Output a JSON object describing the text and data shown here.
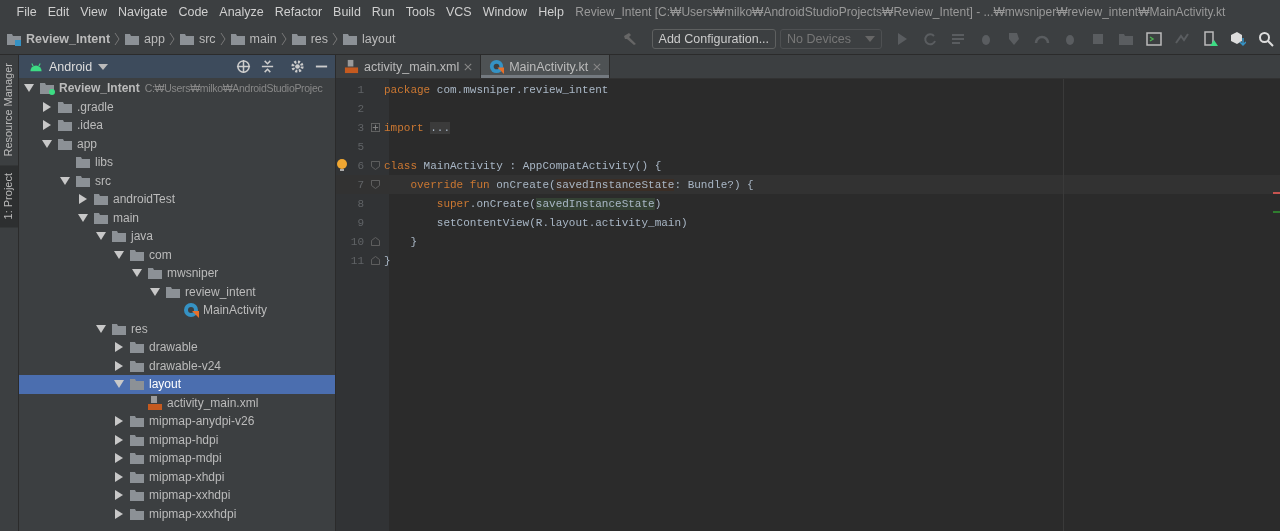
{
  "menu": [
    "File",
    "Edit",
    "View",
    "Navigate",
    "Code",
    "Analyze",
    "Refactor",
    "Build",
    "Run",
    "Tools",
    "VCS",
    "Window",
    "Help"
  ],
  "window": {
    "title": "Review_Intent [C:₩Users₩milko₩AndroidStudioProjects₩Review_Intent] - ...₩mwsniper₩review_intent₩MainActivity.kt"
  },
  "breadcrumb": [
    {
      "label": "Review_Intent",
      "kind": "module"
    },
    {
      "label": "app",
      "kind": "folder"
    },
    {
      "label": "src",
      "kind": "folder"
    },
    {
      "label": "main",
      "kind": "folder"
    },
    {
      "label": "res",
      "kind": "folder"
    },
    {
      "label": "layout",
      "kind": "folder"
    }
  ],
  "toolbar": {
    "config_button": "Add Configuration...",
    "device_select": "No Devices"
  },
  "side_tabs": [
    {
      "label": "Resource Manager",
      "selected": false
    },
    {
      "label": "1: Project",
      "selected": true
    }
  ],
  "project_panel": {
    "view": "Android"
  },
  "tree": [
    {
      "label": "Review_Intent",
      "kind": "module",
      "path": "C:₩Users₩milko₩AndroidStudioProjec",
      "expanded": true,
      "selected": false,
      "children": [
        {
          "label": ".gradle",
          "kind": "folder",
          "expanded": false,
          "selected": false
        },
        {
          "label": ".idea",
          "kind": "folder",
          "expanded": false,
          "selected": false
        },
        {
          "label": "app",
          "kind": "folder",
          "expanded": true,
          "selected": false,
          "children": [
            {
              "label": "libs",
              "kind": "folder",
              "selected": false
            },
            {
              "label": "src",
              "kind": "folder",
              "expanded": true,
              "selected": false,
              "children": [
                {
                  "label": "androidTest",
                  "kind": "folder",
                  "expanded": false,
                  "selected": false
                },
                {
                  "label": "main",
                  "kind": "folder",
                  "expanded": true,
                  "selected": false,
                  "children": [
                    {
                      "label": "java",
                      "kind": "folder",
                      "expanded": true,
                      "selected": false,
                      "children": [
                        {
                          "label": "com",
                          "kind": "folder",
                          "expanded": true,
                          "selected": false,
                          "children": [
                            {
                              "label": "mwsniper",
                              "kind": "folder",
                              "expanded": true,
                              "selected": false,
                              "children": [
                                {
                                  "label": "review_intent",
                                  "kind": "folder",
                                  "expanded": true,
                                  "selected": false,
                                  "children": [
                                    {
                                      "label": "MainActivity",
                                      "kind": "kotlin",
                                      "selected": false
                                    }
                                  ]
                                }
                              ]
                            }
                          ]
                        }
                      ]
                    },
                    {
                      "label": "res",
                      "kind": "folder",
                      "expanded": true,
                      "selected": false,
                      "children": [
                        {
                          "label": "drawable",
                          "kind": "folder",
                          "expanded": false,
                          "selected": false
                        },
                        {
                          "label": "drawable-v24",
                          "kind": "folder",
                          "expanded": false,
                          "selected": false
                        },
                        {
                          "label": "layout",
                          "kind": "folder",
                          "expanded": true,
                          "selected": true,
                          "children": [
                            {
                              "label": "activity_main.xml",
                              "kind": "xml",
                              "selected": false
                            }
                          ]
                        },
                        {
                          "label": "mipmap-anydpi-v26",
                          "kind": "folder",
                          "expanded": false,
                          "selected": false
                        },
                        {
                          "label": "mipmap-hdpi",
                          "kind": "folder",
                          "expanded": false,
                          "selected": false
                        },
                        {
                          "label": "mipmap-mdpi",
                          "kind": "folder",
                          "expanded": false,
                          "selected": false
                        },
                        {
                          "label": "mipmap-xhdpi",
                          "kind": "folder",
                          "expanded": false,
                          "selected": false
                        },
                        {
                          "label": "mipmap-xxhdpi",
                          "kind": "folder",
                          "expanded": false,
                          "selected": false
                        },
                        {
                          "label": "mipmap-xxxhdpi",
                          "kind": "folder",
                          "expanded": false,
                          "selected": false
                        }
                      ]
                    }
                  ]
                }
              ]
            }
          ]
        }
      ]
    }
  ],
  "editor_tabs": [
    {
      "label": "activity_main.xml",
      "kind": "xml",
      "selected": false
    },
    {
      "label": "MainActivity.kt",
      "kind": "kotlin",
      "selected": true
    }
  ],
  "code": [
    {
      "number": "1",
      "kind": "plain",
      "tokens": [
        {
          "text": "package ",
          "kind": "kw"
        },
        {
          "text": "com.mwsniper.review_intent",
          "kind": "plain"
        }
      ]
    },
    {
      "number": "2",
      "kind": "plain"
    },
    {
      "number": "3",
      "kind": "folded",
      "tokens": [
        {
          "text": "import ",
          "kind": "kw"
        },
        {
          "text": "...",
          "kind": "folded"
        }
      ]
    },
    {
      "number": "5",
      "kind": "plain"
    },
    {
      "number": "6",
      "kind": "fold-start",
      "tokens": [
        {
          "text": "class ",
          "kind": "kw"
        },
        {
          "text": "MainActivity : AppCompatActivity() {",
          "kind": "plain"
        }
      ]
    },
    {
      "number": "7",
      "kind": "fold-start",
      "current": true,
      "tokens": [
        {
          "text": "    override fun ",
          "kind": "kw"
        },
        {
          "text": "onCreate(",
          "kind": "plain"
        },
        {
          "text": "savedInstanceState",
          "kind": "param"
        },
        {
          "text": ": Bundle?) {",
          "kind": "plain"
        }
      ]
    },
    {
      "number": "8",
      "kind": "plain",
      "tokens": [
        {
          "text": "        super",
          "kind": "kw"
        },
        {
          "text": ".onCreate(",
          "kind": "plain"
        },
        {
          "text": "savedInstanceState",
          "kind": "usage"
        },
        {
          "text": ")",
          "kind": "plain"
        }
      ]
    },
    {
      "number": "9",
      "kind": "plain",
      "tokens": [
        {
          "text": "        setContentView(R.layout.activity_main)",
          "kind": "plain"
        }
      ]
    },
    {
      "number": "10",
      "kind": "fold-end",
      "tokens": [
        {
          "text": "    }",
          "kind": "plain"
        }
      ]
    },
    {
      "number": "11",
      "kind": "fold-end",
      "tokens": [
        {
          "text": "}",
          "kind": "plain"
        }
      ]
    }
  ]
}
